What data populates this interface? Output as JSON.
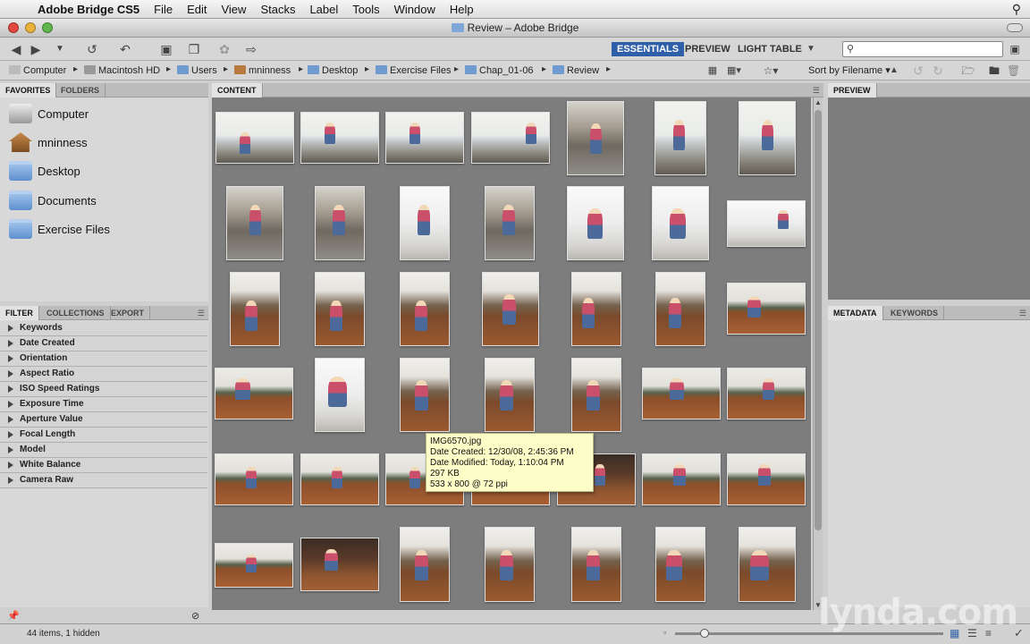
{
  "menubar": {
    "app_name": "Adobe Bridge CS5",
    "items": [
      "File",
      "Edit",
      "View",
      "Stacks",
      "Label",
      "Tools",
      "Window",
      "Help"
    ]
  },
  "window": {
    "title": "Review – Adobe Bridge"
  },
  "workspaces": [
    {
      "label": "ESSENTIALS",
      "active": true
    },
    {
      "label": "PREVIEW",
      "active": false
    },
    {
      "label": "LIGHT TABLE",
      "active": false
    }
  ],
  "search": {
    "placeholder": ""
  },
  "path": [
    "Computer",
    "Macintosh HD",
    "Users",
    "mninness",
    "Desktop",
    "Exercise Files",
    "Chap_01-06",
    "Review"
  ],
  "sort": {
    "label": "Sort by Filename"
  },
  "left_panel": {
    "tabs": [
      "FAVORITES",
      "FOLDERS"
    ],
    "favorites": [
      "Computer",
      "mninness",
      "Desktop",
      "Documents",
      "Exercise Files"
    ]
  },
  "filter_panel": {
    "tabs": [
      "FILTER",
      "COLLECTIONS",
      "EXPORT"
    ],
    "categories": [
      "Keywords",
      "Date Created",
      "Orientation",
      "Aspect Ratio",
      "ISO Speed Ratings",
      "Exposure Time",
      "Aperture Value",
      "Focal Length",
      "Model",
      "White Balance",
      "Camera Raw"
    ]
  },
  "content_panel": {
    "tab": "CONTENT"
  },
  "preview_panel": {
    "tab": "PREVIEW"
  },
  "metadata_panel": {
    "tabs": [
      "METADATA",
      "KEYWORDS"
    ]
  },
  "tooltip": {
    "filename": "IMG6570.jpg",
    "date_created": "Date Created: 12/30/08, 2:45:36 PM",
    "date_modified": "Date Modified: Today, 1:10:04 PM",
    "size": "297 KB",
    "dimensions": "533 x 800 @ 72 ppi"
  },
  "status": {
    "count": "44 items, 1 hidden"
  },
  "watermark": "lynda.com",
  "colors": {
    "accent": "#2f5fa8",
    "content_bg": "#7d7d7d",
    "tooltip_bg": "#fdfdc8"
  }
}
